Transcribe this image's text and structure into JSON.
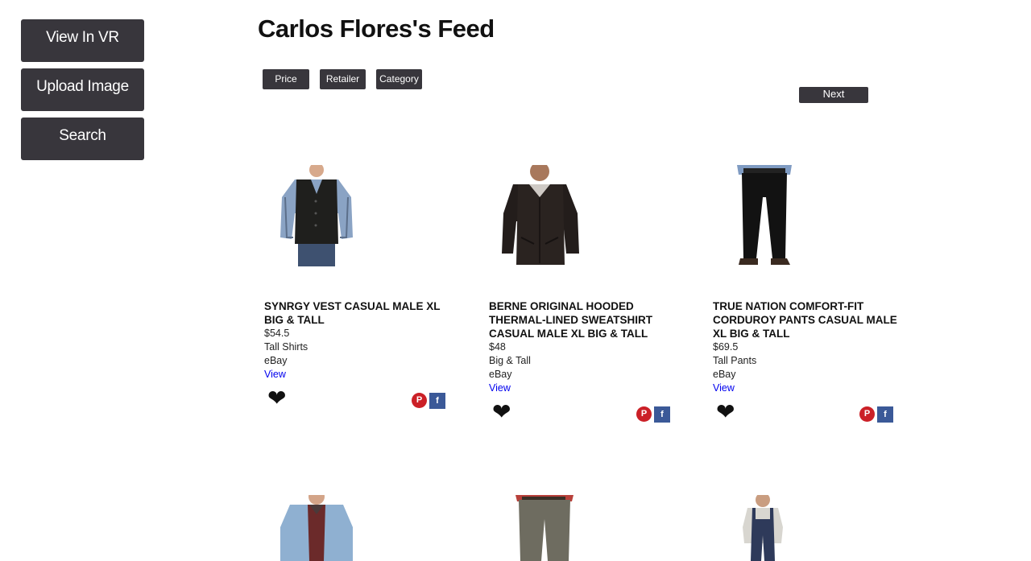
{
  "sidebar": {
    "view_vr": "View In VR",
    "upload_image": "Upload Image",
    "search": "Search"
  },
  "page": {
    "title": "Carlos Flores's Feed"
  },
  "filters": {
    "price": "Price",
    "retailer": "Retailer",
    "category": "Category"
  },
  "pagination": {
    "next": "Next"
  },
  "products": [
    {
      "name": "SYNRGY VEST CASUAL MALE XL BIG & TALL",
      "price": "$54.5",
      "category": "Tall Shirts",
      "retailer": "eBay",
      "view": "View"
    },
    {
      "name": "BERNE ORIGINAL HOODED THERMAL-LINED SWEATSHIRT CASUAL MALE XL BIG & TALL",
      "price": "$48",
      "category": "Big & Tall",
      "retailer": "eBay",
      "view": "View"
    },
    {
      "name": "TRUE NATION COMFORT-FIT CORDUROY PANTS CASUAL MALE XL BIG & TALL",
      "price": "$69.5",
      "category": "Tall Pants",
      "retailer": "eBay",
      "view": "View"
    }
  ],
  "icons": {
    "heart": "heart-icon",
    "pinterest": "pinterest-icon",
    "facebook": "facebook-icon"
  },
  "colors": {
    "button_bg": "#38363c",
    "link": "#0000ee",
    "pinterest": "#cb2027",
    "facebook": "#3b5998"
  }
}
